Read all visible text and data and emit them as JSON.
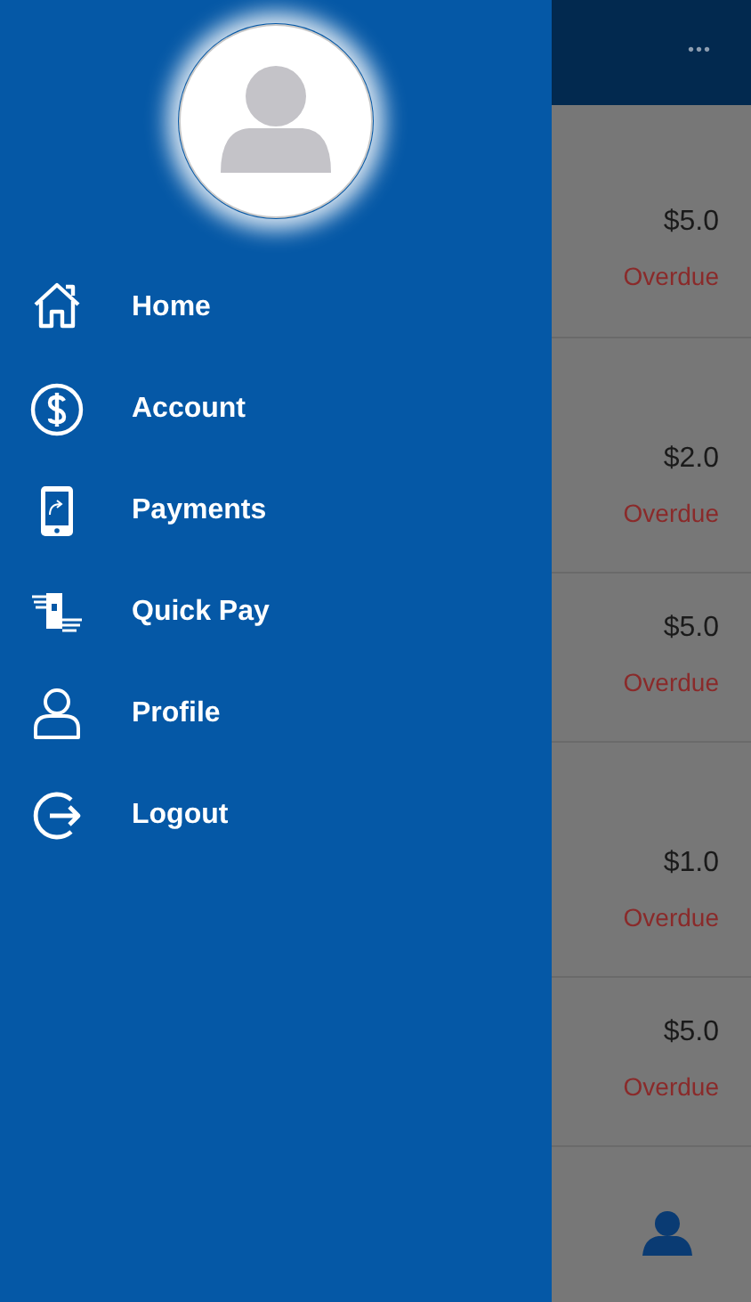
{
  "header": {
    "more_icon": "•••"
  },
  "drawer": {
    "menu": [
      {
        "kind": "home",
        "label": "Home"
      },
      {
        "kind": "account",
        "label": "Account"
      },
      {
        "kind": "payments",
        "label": "Payments"
      },
      {
        "kind": "quickpay",
        "label": "Quick Pay"
      },
      {
        "kind": "profile",
        "label": "Profile"
      },
      {
        "kind": "logout",
        "label": "Logout"
      }
    ]
  },
  "bills": [
    {
      "amount": "$5.0",
      "status": "Overdue"
    },
    {
      "amount": "$2.0",
      "status": "Overdue"
    },
    {
      "amount": "$5.0",
      "status": "Overdue"
    },
    {
      "amount": "$1.0",
      "status": "Overdue"
    },
    {
      "amount": "$5.0",
      "status": "Overdue"
    }
  ]
}
